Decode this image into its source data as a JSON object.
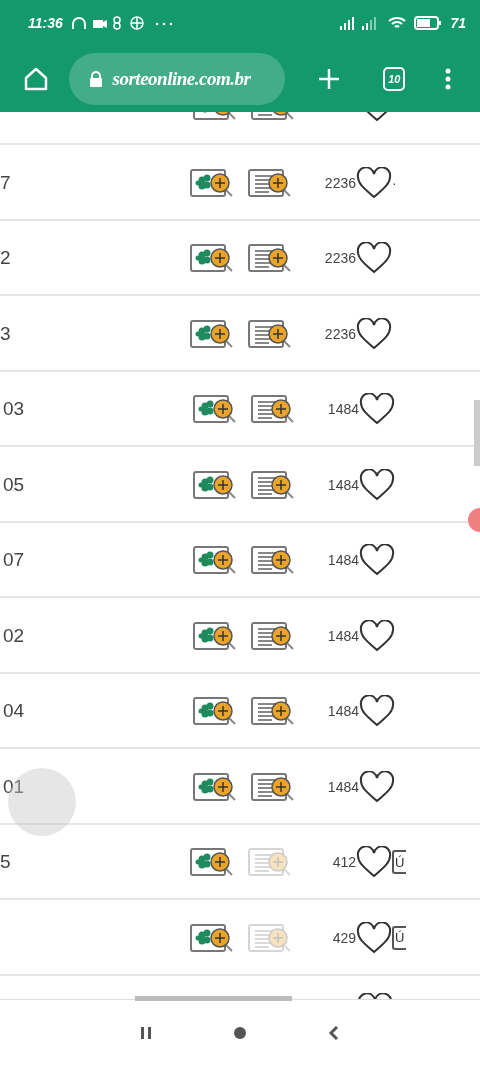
{
  "status_bar": {
    "time": "11:36",
    "battery": "71"
  },
  "browser": {
    "url": "sorteonline.com.br",
    "tab_count": "10"
  },
  "rows": [
    {
      "kind": "partial_top",
      "details_disabled": false
    },
    {
      "label": "7",
      "count": "2236",
      "details_disabled": false,
      "trailing": "·"
    },
    {
      "label": "2",
      "count": "2236",
      "details_disabled": false
    },
    {
      "label": "3",
      "count": "2236",
      "details_disabled": false
    },
    {
      "label": "03",
      "count": "1484",
      "details_disabled": false
    },
    {
      "label": "05",
      "count": "1484",
      "details_disabled": false
    },
    {
      "label": "07",
      "count": "1484",
      "details_disabled": false
    },
    {
      "label": "02",
      "count": "1484",
      "details_disabled": false
    },
    {
      "label": "04",
      "count": "1484",
      "details_disabled": false
    },
    {
      "label": "01",
      "count": "1484",
      "details_disabled": false
    },
    {
      "label": "5",
      "count": "412",
      "details_disabled": true,
      "action": "Ú"
    },
    {
      "count": "429",
      "details_disabled": true,
      "action": "Ú"
    },
    {
      "kind": "partial_bottom"
    }
  ]
}
